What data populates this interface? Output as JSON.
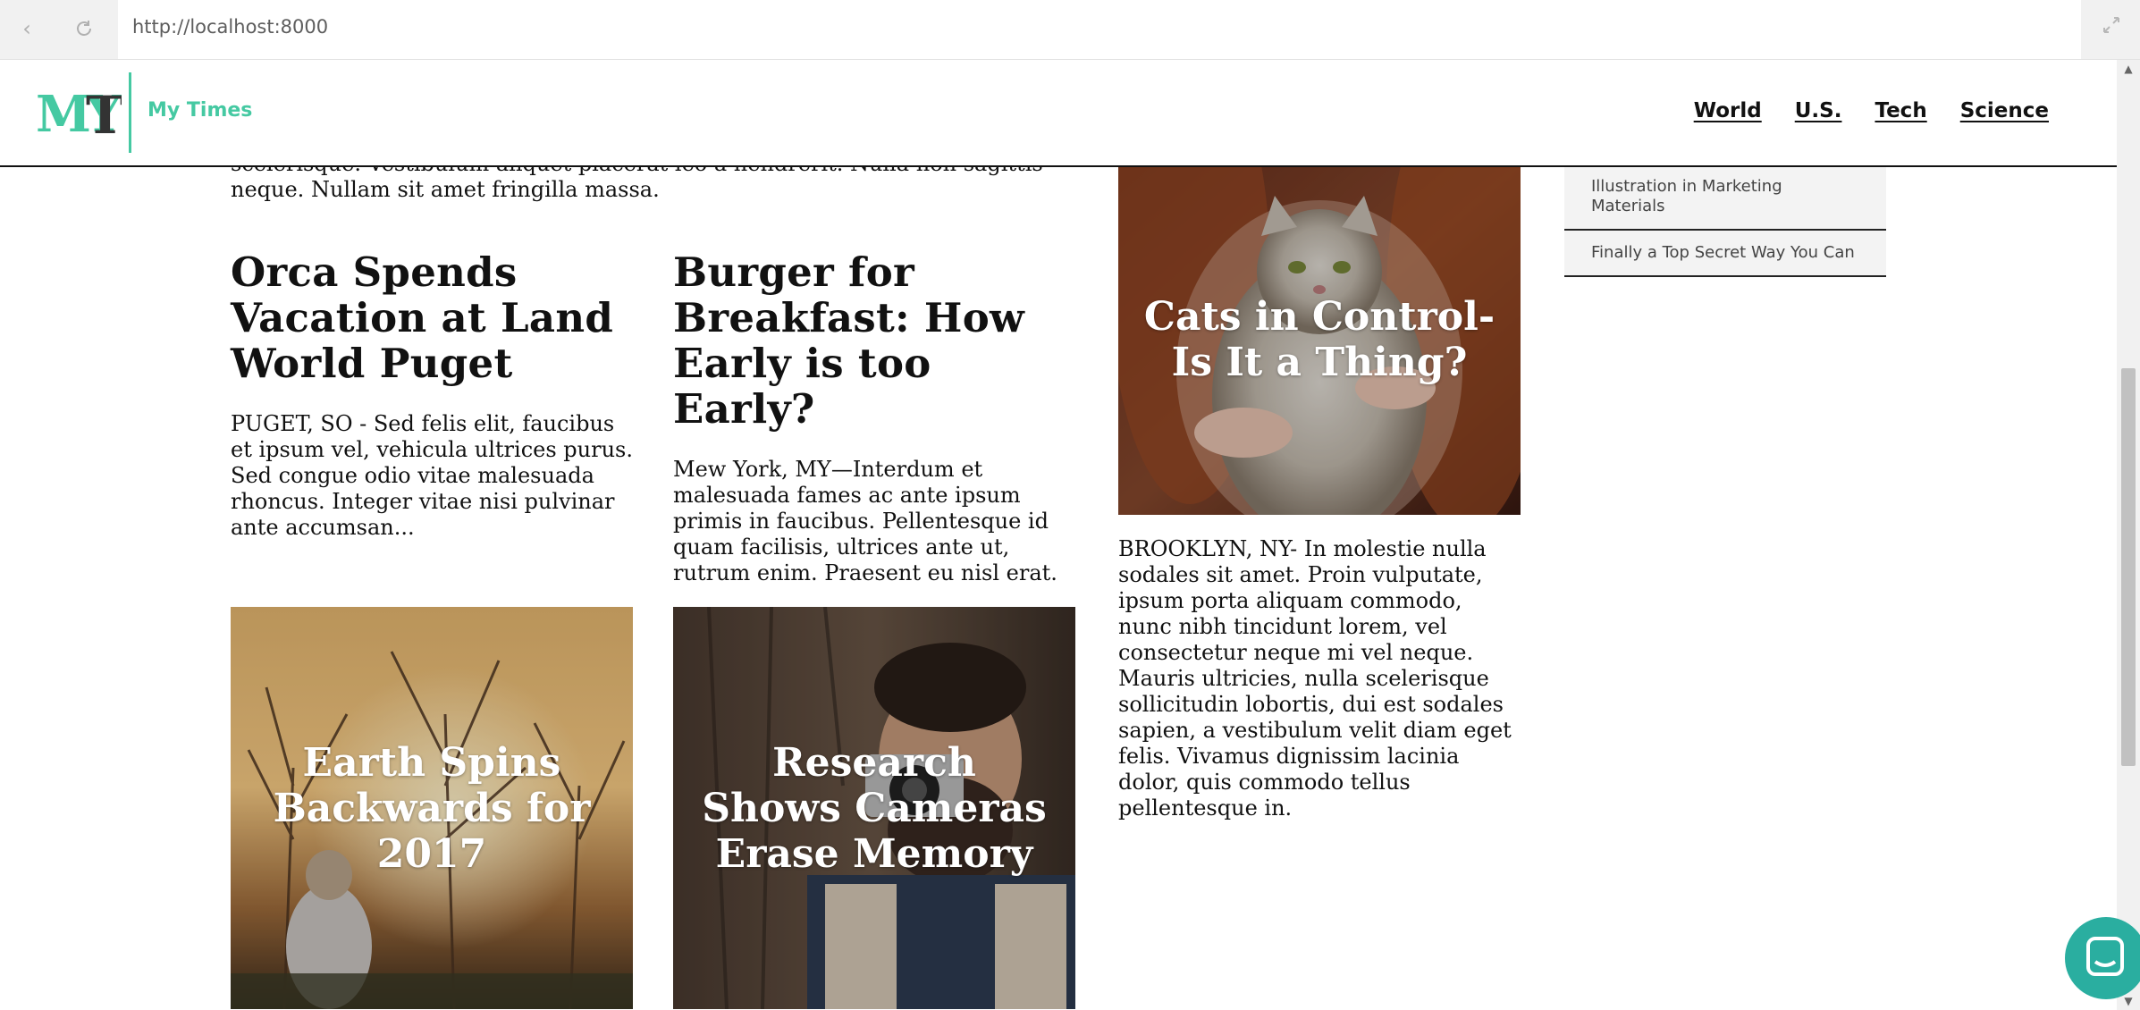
{
  "browser": {
    "url": "http://localhost:8000",
    "back_icon": "chevron-left",
    "reload_icon": "reload",
    "expand_icon": "expand-arrows"
  },
  "header": {
    "logo_text": "MYT",
    "site_name": "My Times",
    "accent_color": "#45c9a2",
    "nav": [
      "World",
      "U.S.",
      "Tech",
      "Science"
    ]
  },
  "content": {
    "clipped_paragraph": "scelerisque. Vestibulum aliquet placerat leo a hendrerit. Nulla non sagittis neque. Nullam sit amet fringilla massa.",
    "stories": [
      {
        "headline": "Orca Spends Vacation at Land World Puget",
        "summary": "PUGET, SO - Sed felis elit, faucibus et ipsum vel, vehicula ultrices purus. Sed congue odio vitae malesuada rhoncus. Integer vitae nisi pulvinar ante accumsan..."
      },
      {
        "headline": "Burger for Breakfast: How Early is too Early?",
        "summary": "Mew York, MY—Interdum et malesuada fames ac ante ipsum primis in faucibus. Pellentesque id quam facilisis, ultrices ante ut, rutrum enim. Praesent eu nisl erat."
      }
    ],
    "feature": {
      "headline": "Cats in Control-Is It a Thing?",
      "summary": "BROOKLYN, NY- In molestie nulla sodales sit amet. Proin vulputate, ipsum porta aliquam commodo, nunc nibh tincidunt lorem, vel consectetur neque mi vel neque. Mauris ultricies, nulla scelerisque sollicitudin lobortis, dui est sodales sapien, a vestibulum velit diam eget felis. Vivamus dignissim lacinia dolor, quis commodo tellus pellentesque in."
    },
    "photo_stories": [
      {
        "headline": "Earth Spins Backwards for 2017"
      },
      {
        "headline": "Research Shows Cameras Erase Memory"
      }
    ]
  },
  "sidebar": {
    "items": [
      "Illustration in Marketing Materials",
      "Finally a Top Secret Way You Can"
    ]
  },
  "chat": {
    "icon": "chat-icon"
  }
}
